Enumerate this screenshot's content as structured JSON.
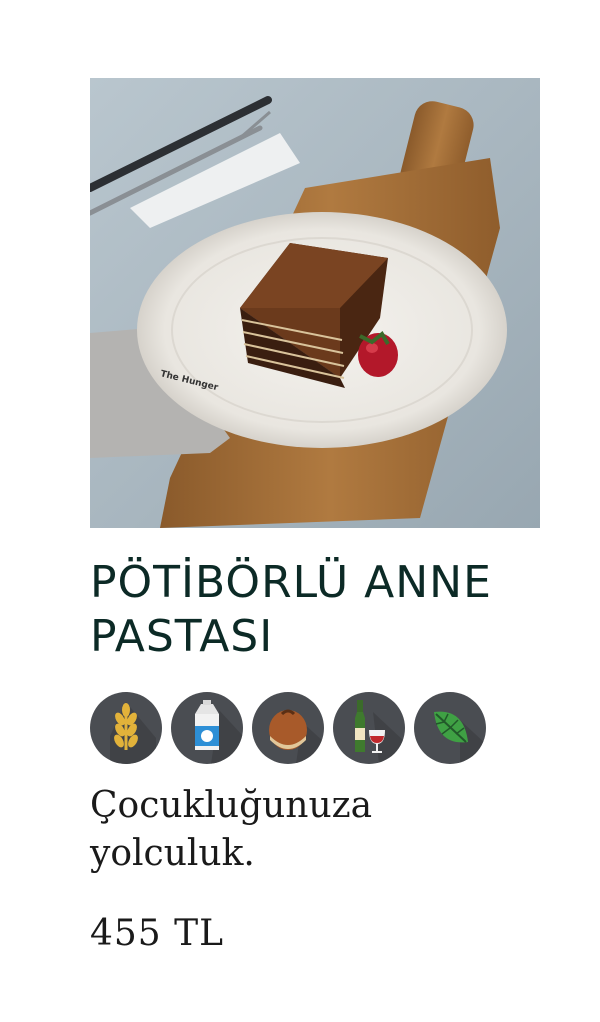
{
  "product": {
    "image_alt": "Pötibörlü anne pastası dilimi",
    "plate_logo": "The Hunger",
    "title": "PÖTİBÖRLÜ ANNE PASTASI",
    "allergen_icons": [
      "gluten-wheat-icon",
      "milk-icon",
      "hazelnut-icon",
      "alcohol-icon",
      "vegetarian-leaf-icon"
    ],
    "description": "Çocukluğunuza yolculuk.",
    "price": "455 TL"
  },
  "colors": {
    "title": "#0c2a26",
    "allergen_bg": "#4a4d52",
    "text": "#1a1a1a"
  }
}
